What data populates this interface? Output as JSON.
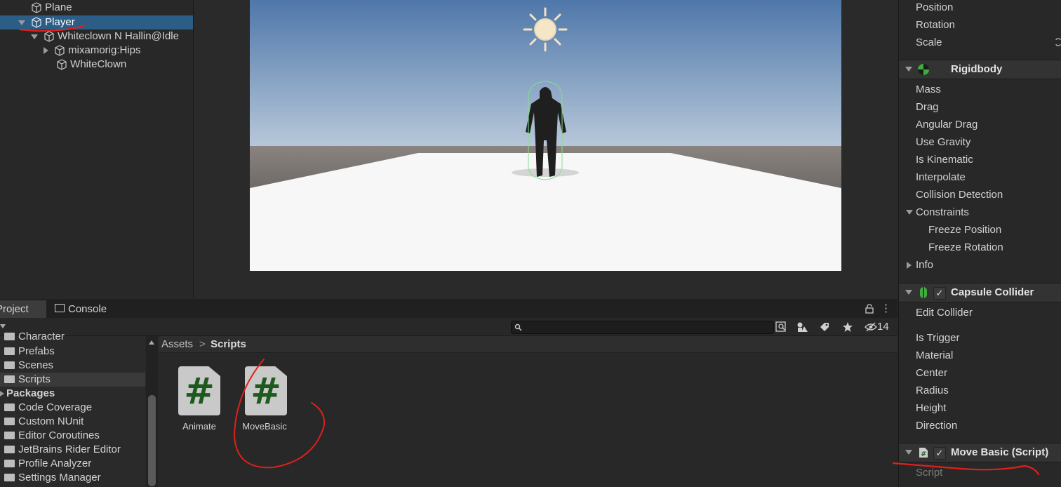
{
  "hierarchy": {
    "items": [
      {
        "label": "Plane"
      },
      {
        "label": "Player"
      },
      {
        "label": "Whiteclown N Hallin@Idle"
      },
      {
        "label": "mixamorig:Hips"
      },
      {
        "label": "WhiteClown"
      }
    ]
  },
  "project": {
    "tabs": [
      {
        "label": "Project"
      },
      {
        "label": "Console"
      }
    ],
    "search_placeholder": "",
    "hidden_count": "14",
    "tree": [
      {
        "label": "Character"
      },
      {
        "label": "Prefabs"
      },
      {
        "label": "Scenes"
      },
      {
        "label": "Scripts"
      },
      {
        "label": "Packages"
      },
      {
        "label": "Code Coverage"
      },
      {
        "label": "Custom NUnit"
      },
      {
        "label": "Editor Coroutines"
      },
      {
        "label": "JetBrains Rider Editor"
      },
      {
        "label": "Profile Analyzer"
      },
      {
        "label": "Settings Manager"
      }
    ],
    "breadcrumb": {
      "root": "Assets",
      "separator": ">",
      "current": "Scripts"
    },
    "assets": [
      {
        "label": "Animate",
        "glyph": "#"
      },
      {
        "label": "MoveBasic",
        "glyph": "#"
      }
    ]
  },
  "inspector": {
    "transform_props": [
      "Position",
      "Rotation",
      "Scale"
    ],
    "rigidbody": {
      "title": "Rigidbody",
      "props": [
        "Mass",
        "Drag",
        "Angular Drag",
        "Use Gravity",
        "Is Kinematic",
        "Interpolate",
        "Collision Detection"
      ],
      "constraints": "Constraints",
      "constraint_items": [
        "Freeze Position",
        "Freeze Rotation"
      ],
      "info": "Info"
    },
    "capsule_collider": {
      "title": "Capsule Collider",
      "edit": "Edit Collider",
      "props": [
        "Is Trigger",
        "Material",
        "Center",
        "Radius",
        "Height",
        "Direction"
      ]
    },
    "move_basic": {
      "title": "Move Basic (Script)",
      "props": [
        "Script"
      ]
    },
    "check_mark": "✓"
  },
  "colors": {
    "selection": "#2c5d87",
    "annotation": "#e0201a",
    "panel": "#282828"
  }
}
